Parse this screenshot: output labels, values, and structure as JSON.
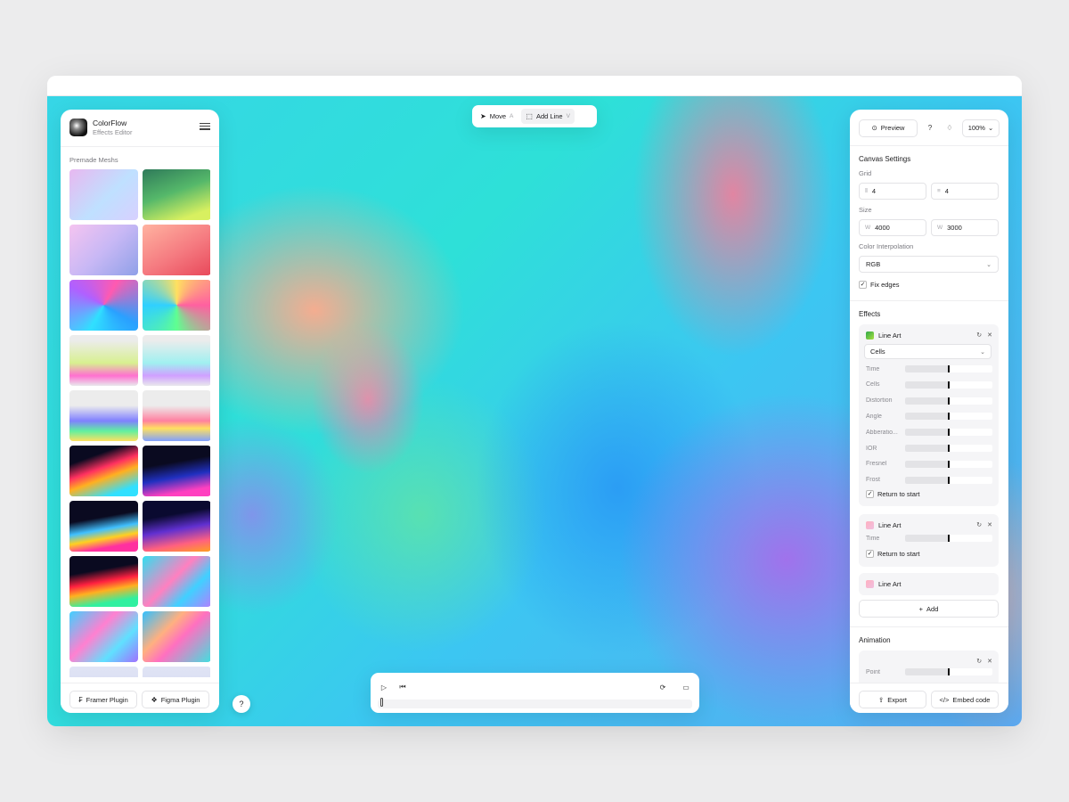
{
  "app": {
    "name": "ColorFlow",
    "subtitle": "Effects Editor"
  },
  "left": {
    "section_title": "Premade Meshs",
    "meshes": [
      {
        "name": "mesh-1",
        "bg": "linear-gradient(135deg,#e8b8f0,#bfe0ff 55%,#d8d0ff)"
      },
      {
        "name": "mesh-2",
        "bg": "linear-gradient(160deg,#2f7a5a,#55b86a 45%,#d8f060 85%)"
      },
      {
        "name": "mesh-3",
        "bg": "linear-gradient(135deg,#f5c4f0,#c8b8f5 50%,#8fa0e8)"
      },
      {
        "name": "mesh-4",
        "bg": "linear-gradient(150deg,#ffb3a0,#f57a80 55%,#e8485a)"
      },
      {
        "name": "mesh-5",
        "bg": "conic-gradient(from 30deg at 50% 50%,#ff5ab0,#2aa0ff,#30e0ff,#b060ff,#ff5ab0)"
      },
      {
        "name": "mesh-6",
        "bg": "conic-gradient(from 90deg at 50% 50%,#ff60a0,#60ff90,#30d0ff,#ffe060,#ff60a0)"
      },
      {
        "name": "mesh-7",
        "bg": "linear-gradient(180deg,#ececec 10%,#d8f090 55%,#ff70d0 80%,#e8e8ec)"
      },
      {
        "name": "mesh-8",
        "bg": "linear-gradient(180deg,#ececec 10%,#a0f0f0 55%,#d0a0ff 80%,#e8e8ec)"
      },
      {
        "name": "mesh-9",
        "bg": "linear-gradient(180deg,#ececec 30%,#8080ff 60%,#60f0a0 80%,#ffe060)"
      },
      {
        "name": "mesh-10",
        "bg": "linear-gradient(180deg,#ececec 30%,#ff80a0 60%,#ffe060 75%,#80a0ff)"
      },
      {
        "name": "mesh-11",
        "bg": "linear-gradient(160deg,#0a0a20 25%,#ff3060 45%,#ffb020 60%,#30e0ff 85%)"
      },
      {
        "name": "mesh-12",
        "bg": "linear-gradient(170deg,#0a0a20 35%,#2030c0 60%,#ff40c0 85%)"
      },
      {
        "name": "mesh-13",
        "bg": "linear-gradient(170deg,#0a0a20 35%,#40c0ff 55%,#ffd020 70%,#ff30a0 85%)"
      },
      {
        "name": "mesh-14",
        "bg": "linear-gradient(170deg,#0a0a30 30%,#6030d0 55%,#ff6080 80%,#ffa020)"
      },
      {
        "name": "mesh-15",
        "bg": "linear-gradient(170deg,#0a0a20 30%,#ff2040 50%,#ffb020 65%,#30f0a0 85%)"
      },
      {
        "name": "mesh-16",
        "bg": "linear-gradient(135deg,#30e0f0,#ff80c0 45%,#40d0ff 70%,#b080ff)"
      },
      {
        "name": "mesh-17",
        "bg": "linear-gradient(135deg,#40d0ff,#ff80d0 40%,#60e0ff 70%,#a070ff)"
      },
      {
        "name": "mesh-18",
        "bg": "linear-gradient(135deg,#30c0ff,#ffb080 35%,#ff70c0 55%,#40e0e0)"
      },
      {
        "name": "mesh-19",
        "bg": "linear-gradient(180deg,#e0e4f5,#d0d4f0)"
      },
      {
        "name": "mesh-20",
        "bg": "linear-gradient(180deg,#e0e4f5,#d0d4f0)"
      }
    ],
    "framer_plugin": "Framer Plugin",
    "figma_plugin": "Figma Plugin"
  },
  "toolbar": {
    "move_label": "Move",
    "move_key": "A",
    "add_line_label": "Add Line",
    "add_line_key": "V"
  },
  "help_label": "?",
  "timeline": {
    "playhead_fraction": 0.0
  },
  "right": {
    "preview_label": "Preview",
    "help_label": "?",
    "zoom": "100%",
    "canvas_settings_title": "Canvas Settings",
    "grid_label": "Grid",
    "grid_cols": "4",
    "grid_rows": "4",
    "size_label": "Size",
    "width_prefix": "W",
    "height_prefix": "W",
    "width": "4000",
    "height": "3000",
    "interp_label": "Color Interpolation",
    "interp_value": "RGB",
    "fix_edges_label": "Fix edges",
    "effects_title": "Effects",
    "effect1": {
      "name": "Line Art",
      "swatch": "linear-gradient(135deg,#2fa84a,#a8e040)",
      "mode": "Cells",
      "params": [
        {
          "label": "Time",
          "value": 0.5
        },
        {
          "label": "Cells",
          "value": 0.5
        },
        {
          "label": "Distortion",
          "value": 0.5
        },
        {
          "label": "Angle",
          "value": 0.5
        },
        {
          "label": "Abberatio...",
          "value": 0.5
        },
        {
          "label": "IOR",
          "value": 0.5
        },
        {
          "label": "Fresnel",
          "value": 0.5
        },
        {
          "label": "Frost",
          "value": 0.5
        }
      ],
      "return_label": "Return to start"
    },
    "effect2": {
      "name": "Line Art",
      "swatch": "linear-gradient(135deg,#ffb0c0,#f0c0e0)",
      "params": [
        {
          "label": "Time",
          "value": 0.5
        }
      ],
      "return_label": "Return to start"
    },
    "effect3": {
      "name": "Line Art",
      "swatch": "linear-gradient(135deg,#ffb0c0,#f0c0e0)"
    },
    "add_label": "Add",
    "animation_title": "Animation",
    "animation_param": {
      "label": "Point",
      "value": 0.5
    },
    "export_label": "Export",
    "embed_label": "Embed code"
  }
}
